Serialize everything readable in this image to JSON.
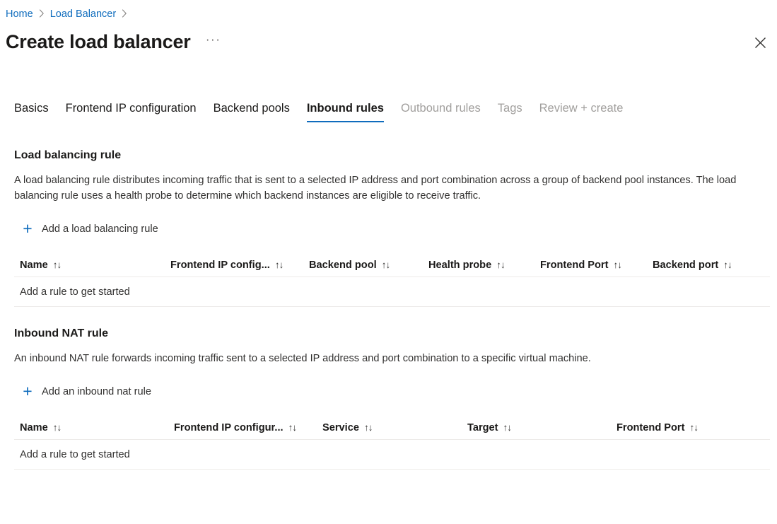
{
  "breadcrumb": {
    "items": [
      {
        "label": "Home"
      },
      {
        "label": "Load Balancer"
      }
    ],
    "separator_icon": "chevron-right-icon"
  },
  "header": {
    "title": "Create load balancer",
    "more_label": "···",
    "more_icon": "ellipsis-icon",
    "close_icon": "close-icon"
  },
  "tabs": [
    {
      "label": "Basics",
      "state": "enabled"
    },
    {
      "label": "Frontend IP configuration",
      "state": "enabled"
    },
    {
      "label": "Backend pools",
      "state": "enabled"
    },
    {
      "label": "Inbound rules",
      "state": "active"
    },
    {
      "label": "Outbound rules",
      "state": "disabled"
    },
    {
      "label": "Tags",
      "state": "disabled"
    },
    {
      "label": "Review + create",
      "state": "disabled"
    }
  ],
  "colors": {
    "accent": "#0f6cbd",
    "link": "#0f6cbd",
    "text": "#1b1a19",
    "secondary_text": "#323130",
    "disabled_text": "#a19f9d",
    "divider": "#edebe9",
    "background": "#ffffff"
  },
  "load_balancing_rule": {
    "title": "Load balancing rule",
    "description": "A load balancing rule distributes incoming traffic that is sent to a selected IP address and port combination across a group of backend pool instances. The load balancing rule uses a health probe to determine which backend instances are eligible to receive traffic.",
    "add_label": "Add a load balancing rule",
    "add_icon": "plus-icon",
    "columns": [
      {
        "label": "Name",
        "sort_icon": "sort-arrows-icon"
      },
      {
        "label": "Frontend IP config...",
        "sort_icon": "sort-arrows-icon"
      },
      {
        "label": "Backend pool",
        "sort_icon": "sort-arrows-icon"
      },
      {
        "label": "Health probe",
        "sort_icon": "sort-arrows-icon"
      },
      {
        "label": "Frontend Port",
        "sort_icon": "sort-arrows-icon"
      },
      {
        "label": "Backend port",
        "sort_icon": "sort-arrows-icon"
      }
    ],
    "empty_message": "Add a rule to get started",
    "rows": []
  },
  "inbound_nat_rule": {
    "title": "Inbound NAT rule",
    "description": "An inbound NAT rule forwards incoming traffic sent to a selected IP address and port combination to a specific virtual machine.",
    "add_label": "Add an inbound nat rule",
    "add_icon": "plus-icon",
    "columns": [
      {
        "label": "Name",
        "sort_icon": "sort-arrows-icon"
      },
      {
        "label": "Frontend IP configur...",
        "sort_icon": "sort-arrows-icon"
      },
      {
        "label": "Service",
        "sort_icon": "sort-arrows-icon"
      },
      {
        "label": "Target",
        "sort_icon": "sort-arrows-icon"
      },
      {
        "label": "Frontend Port",
        "sort_icon": "sort-arrows-icon"
      }
    ],
    "empty_message": "Add a rule to get started",
    "rows": []
  },
  "sort_glyph": "↑↓"
}
